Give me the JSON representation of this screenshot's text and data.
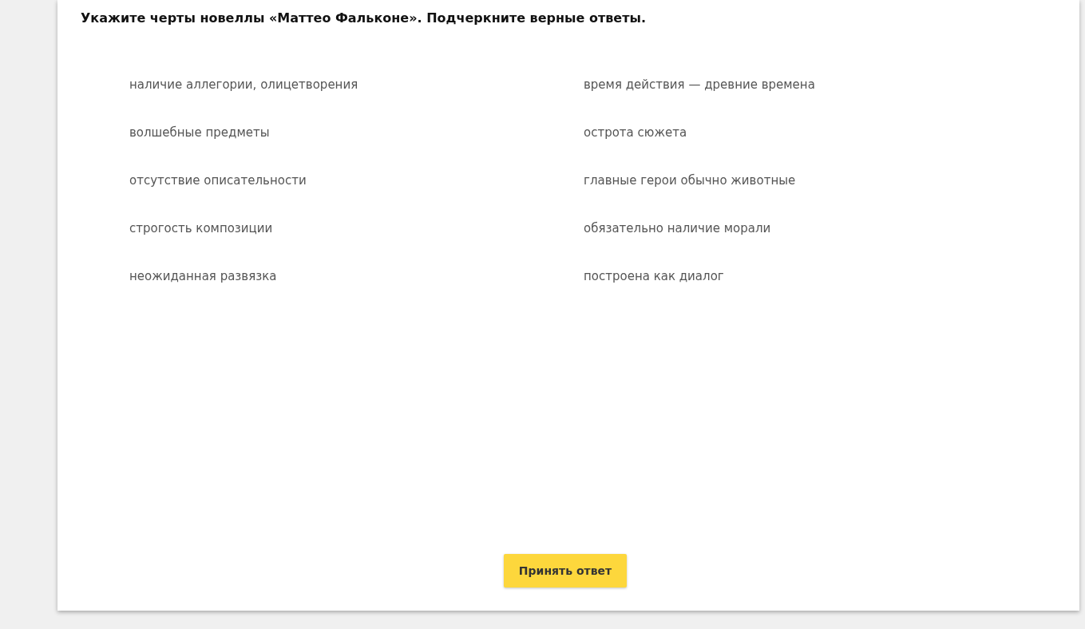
{
  "question": "Укажите черты новеллы «Маттео Фальконе». Подчеркните верные ответы.",
  "options": [
    {
      "label": "наличие аллегории, олицетворения",
      "selected": false
    },
    {
      "label": "время действия — древние времена",
      "selected": false
    },
    {
      "label": "волшебные предметы",
      "selected": false
    },
    {
      "label": "острота сюжета",
      "selected": false
    },
    {
      "label": "отсутствие описательности",
      "selected": false
    },
    {
      "label": "главные герои обычно животные",
      "selected": false
    },
    {
      "label": "строгость композиции",
      "selected": false
    },
    {
      "label": "обязательно наличие морали",
      "selected": false
    },
    {
      "label": "неожиданная развязка",
      "selected": false
    },
    {
      "label": "построена как диалог",
      "selected": false
    }
  ],
  "submit_button": "Принять ответ"
}
